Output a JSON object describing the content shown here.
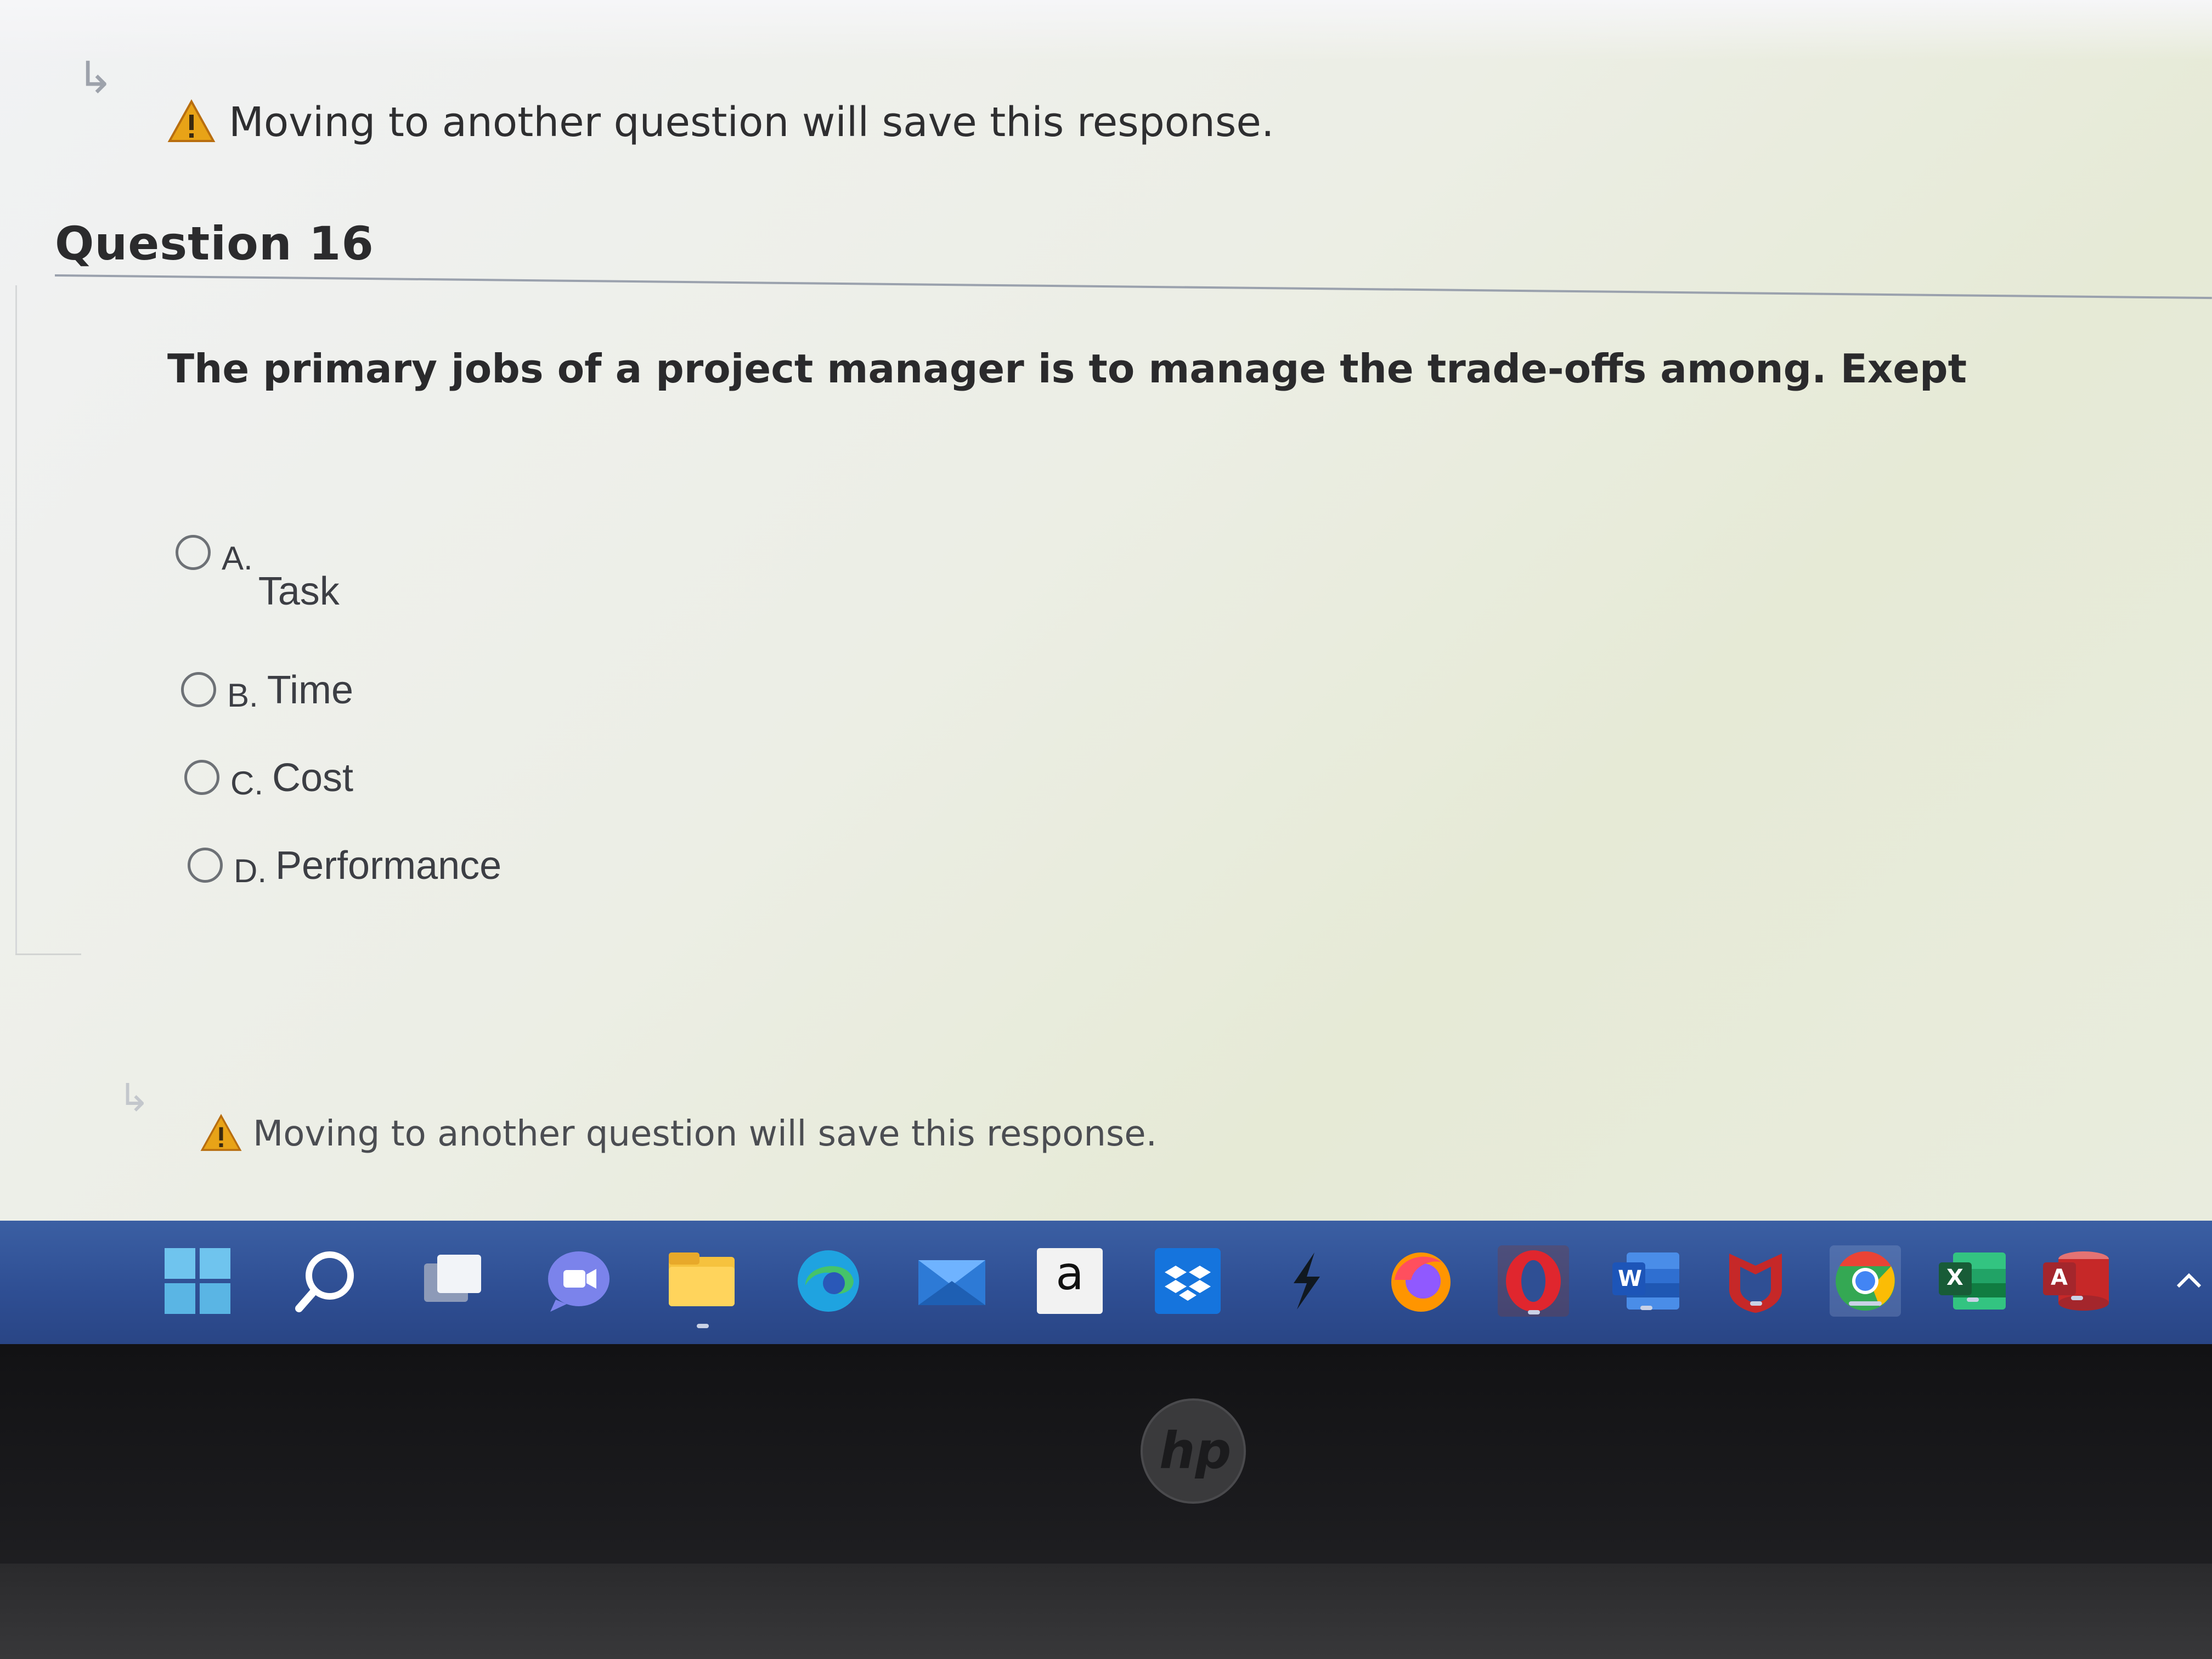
{
  "warning": {
    "top_text": "Moving to another question will save this response.",
    "bottom_text": "Moving to another question will save this response."
  },
  "question": {
    "title": "Question 16",
    "text": "The primary jobs of a project manager is to manage the trade-offs among. Exept",
    "options": [
      {
        "letter": "A.",
        "text": "Task"
      },
      {
        "letter": "B.",
        "text": "Time"
      },
      {
        "letter": "C.",
        "text": "Cost"
      },
      {
        "letter": "D.",
        "text": "Performance"
      }
    ]
  },
  "taskbar": {
    "icons": [
      "windows-start-icon",
      "search-icon",
      "task-view-icon",
      "teams-chat-icon",
      "file-explorer-icon",
      "edge-icon",
      "mail-icon",
      "amazon-icon",
      "dropbox-icon",
      "spike-icon",
      "firefox-icon",
      "opera-icon",
      "word-icon",
      "mcafee-icon",
      "chrome-icon",
      "excel-icon",
      "access-icon"
    ],
    "amazon_letter": "a",
    "word_letter": "W",
    "excel_letter": "X",
    "access_letter": "A"
  },
  "device": {
    "logo": "hp"
  },
  "colors": {
    "taskbar": "#2f4f94",
    "warning": "#e8a317",
    "accent_red": "#d32f2f"
  }
}
